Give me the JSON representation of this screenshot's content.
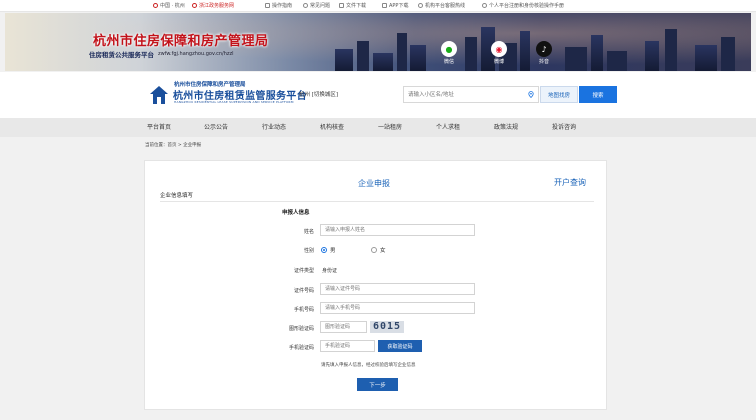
{
  "topbar": {
    "items": [
      "中国 · 杭州",
      "浙江政务服务网",
      "操作指南",
      "常见问题",
      "文件下载",
      "APP下载",
      "机构平台客服热线",
      "个人平台注册和身份核验操作手册"
    ]
  },
  "banner": {
    "title": "杭州市住房保障和房产管理局",
    "subtitle": "住房租赁公共服务平台",
    "url": "zwfw.fgj.hangzhou.gov.cn/hzzl",
    "social": [
      {
        "label": "微信",
        "icon": "wechat-icon"
      },
      {
        "label": "微博",
        "icon": "weibo-icon"
      },
      {
        "label": "抖音",
        "icon": "douyin-icon"
      }
    ]
  },
  "header": {
    "org": "杭州市住房保障和房产管理局",
    "platform": "杭州市住房租赁监管服务平台",
    "platform_en": "HANGZHOU RESIDENTIAL LEASE SUPERVISION AND SERVICE PLATFORM",
    "city": "杭州 [切换城区]",
    "search_placeholder": "请输入小区名/地址",
    "map_button": "地图找房",
    "search_button": "搜索"
  },
  "nav": {
    "items": [
      "平台首页",
      "公示公告",
      "行业动态",
      "机构核查",
      "一站租房",
      "个人求租",
      "政策法规",
      "投诉咨询"
    ]
  },
  "breadcrumb": "当前位置：首页 > 企业申报",
  "form": {
    "tab_active": "企业申报",
    "tab_other": "开户查询",
    "section_title": "企业信息填写",
    "applicant_title": "申报人信息",
    "name_label": "姓名",
    "name_placeholder": "请输入申报人姓名",
    "gender_label": "性别",
    "gender_options": [
      "男",
      "女"
    ],
    "id_type_label": "证件类型",
    "id_type_value": "身份证",
    "id_number_label": "证件号码",
    "id_number_placeholder": "请输入证件号码",
    "phone_label": "手机号码",
    "phone_placeholder": "请输入手机号码",
    "captcha_label": "图形验证码",
    "captcha_placeholder": "图形验证码",
    "captcha_value": "6015",
    "sms_label": "手机验证码",
    "sms_placeholder": "手机验证码",
    "sms_button": "获取验证码",
    "hint": "请先填入申报人信息，经过校验后填写企业信息",
    "next_button": "下一步"
  }
}
